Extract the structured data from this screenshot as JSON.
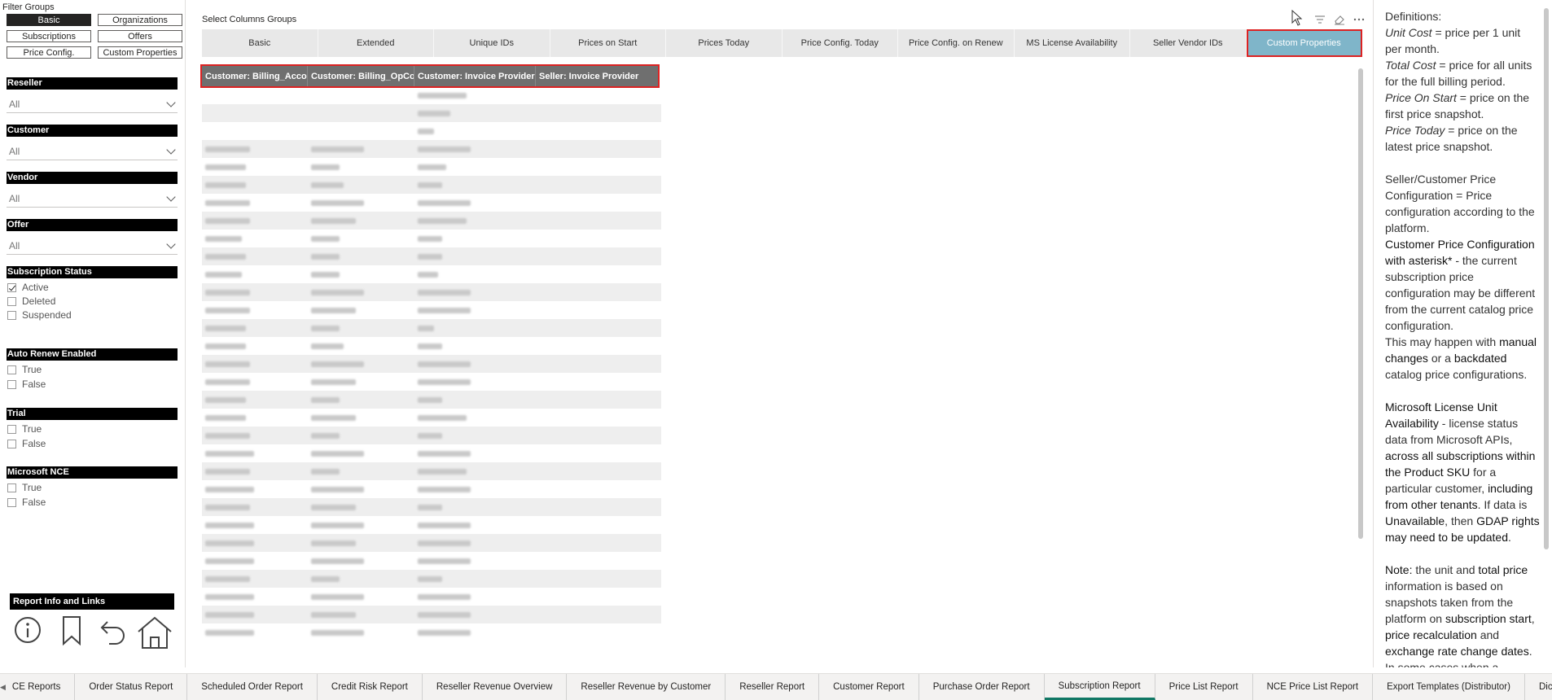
{
  "filter_groups": {
    "title": "Filter Groups",
    "buttons": [
      "Basic",
      "Organizations",
      "Subscriptions",
      "Offers",
      "Price Config.",
      "Custom Properties"
    ],
    "active": "Basic"
  },
  "slicers": {
    "reseller": {
      "label": "Reseller",
      "value": "All"
    },
    "customer": {
      "label": "Customer",
      "value": "All"
    },
    "vendor": {
      "label": "Vendor",
      "value": "All"
    },
    "offer": {
      "label": "Offer",
      "value": "All"
    },
    "subscription_status": {
      "label": "Subscription Status",
      "options": [
        "Active",
        "Deleted",
        "Suspended"
      ],
      "checked": [
        true,
        false,
        false
      ]
    },
    "auto_renew": {
      "label": "Auto Renew Enabled",
      "options": [
        "True",
        "False"
      ]
    },
    "trial": {
      "label": "Trial",
      "options": [
        "True",
        "False"
      ]
    },
    "microsoft_nce": {
      "label": "Microsoft NCE",
      "options": [
        "True",
        "False"
      ]
    }
  },
  "report_info": {
    "title": "Report Info and Links",
    "icons": [
      "info-icon",
      "bookmark-icon",
      "back-icon",
      "home-icon"
    ]
  },
  "main": {
    "select_title": "Select Columns Groups",
    "column_groups": [
      "Basic",
      "Extended",
      "Unique IDs",
      "Prices on Start",
      "Prices Today",
      "Price Config. Today",
      "Price Config. on Renew",
      "MS License Availability",
      "Seller Vendor IDs",
      "Custom Properties"
    ],
    "active_group": "Custom Properties",
    "table_headers": [
      "Customer: Billing_AccountID",
      "Customer: Billing_OpCo",
      "Customer: Invoice Provider",
      "Seller: Invoice Provider"
    ]
  },
  "definitions": {
    "title": "Definitions:",
    "unit_cost_term": "Unit Cost",
    "unit_cost_def": " = price per 1 unit per month.",
    "total_cost_term": "Total Cost",
    "total_cost_def": " = price for all units for the full billing period.",
    "price_start_term": "Price On Start",
    "price_start_def": " = price on the first price snapshot.",
    "price_today_term": "Price Today",
    "price_today_def": " = price on the latest price snapshot.",
    "seller_config": "Seller/Customer Price Configuration = Price configuration according to the platform.",
    "asterisk_lead": "Customer Price Configuration with asterisk*",
    "asterisk_def": " - the current subscription price configuration may be different from the current catalog price configuration.",
    "may_happen_a": "This may happen with ",
    "may_happen_b": "manual changes",
    "may_happen_c": " or a ",
    "may_happen_d": "backdated",
    "may_happen_e": " catalog price configurations.",
    "ms_a": "Microsoft License Unit Availability",
    "ms_b": " - license status data from Microsoft APIs, ",
    "ms_c": "across all subscriptions within the Product SKU",
    "ms_d": " for a particular customer, ",
    "ms_e": "including from other tenants",
    "ms_f": ". If data is ",
    "ms_g": "Unavailable",
    "ms_h": ", then ",
    "ms_i": "GDAP rights may need to be updated",
    "ms_j": ".",
    "note_a": "Note:",
    "note_b": " the unit and ",
    "note_c": "total price",
    "note_d": " information is based on snapshots taken from the platform on ",
    "note_e": "subscription start",
    "note_f": ", ",
    "note_g": "price recalculation",
    "note_h": " and ",
    "note_i": "exchange rate change dates",
    "note_j": ". In some cases when a"
  },
  "page_tabs": [
    "CE Reports",
    "Order Status Report",
    "Scheduled Order Report",
    "Credit Risk Report",
    "Reseller Revenue Overview",
    "Reseller Revenue by Customer",
    "Reseller Report",
    "Customer Report",
    "Purchase Order Report",
    "Subscription Report",
    "Price List Report",
    "NCE Price List Report",
    "Export Templates (Distributor)",
    "Dictionary Report"
  ],
  "active_page": "Subscription Report"
}
